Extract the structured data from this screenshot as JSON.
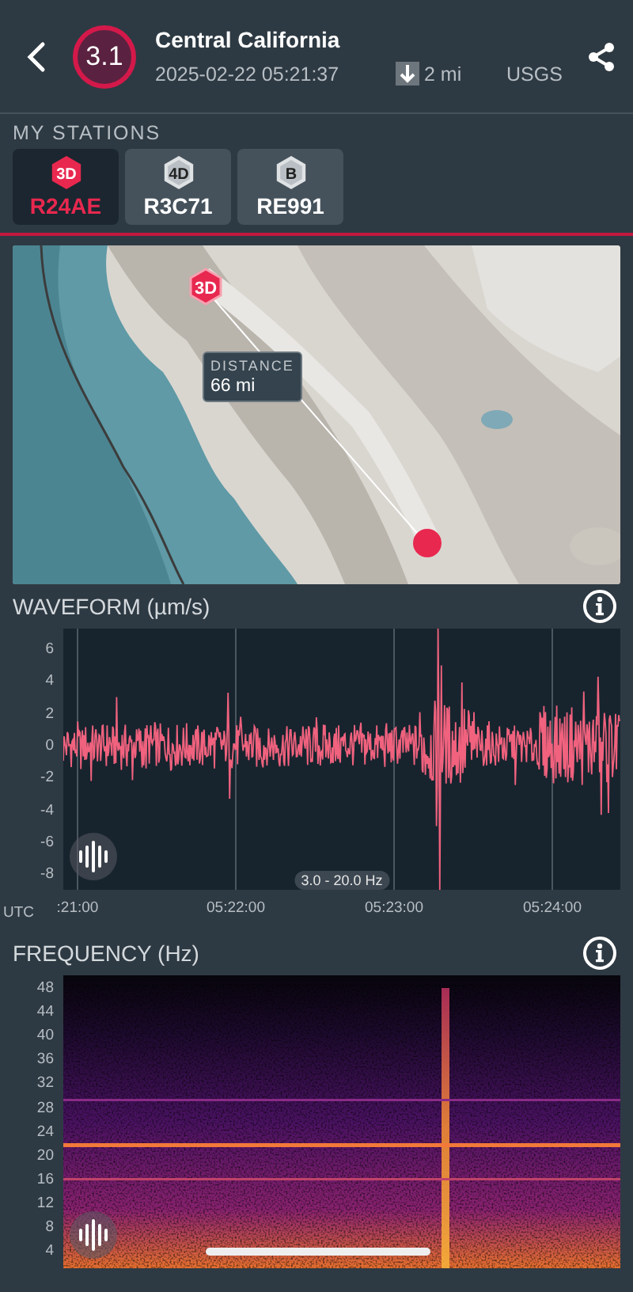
{
  "header": {
    "magnitude": "3.1",
    "title": "Central California",
    "datetime": "2025-02-22 05:21:37",
    "depth": "2 mi",
    "source": "USGS"
  },
  "stations": {
    "label": "MY STATIONS",
    "items": [
      {
        "badge": "3D",
        "name": "R24AE",
        "selected": true
      },
      {
        "badge": "4D",
        "name": "R3C71",
        "selected": false
      },
      {
        "badge": "B",
        "name": "RE991",
        "selected": false
      }
    ]
  },
  "map": {
    "kind": "picture",
    "station_badge": "3D",
    "distance_label": "DISTANCE",
    "distance_value": "66 mi"
  },
  "waveform": {
    "title": "WAVEFORM (µm/s)",
    "y_ticks": [
      "6",
      "4",
      "2",
      "0",
      "-2",
      "-4",
      "-6",
      "-8"
    ],
    "x_axis_label": "UTC",
    "x_ticks": [
      ":21:00",
      "05:22:00",
      "05:23:00",
      "05:24:00"
    ],
    "filter": "3.0 - 20.0 Hz"
  },
  "frequency": {
    "title": "FREQUENCY (Hz)",
    "y_ticks": [
      "48",
      "44",
      "40",
      "36",
      "32",
      "28",
      "24",
      "20",
      "16",
      "12",
      "8",
      "4"
    ]
  }
}
